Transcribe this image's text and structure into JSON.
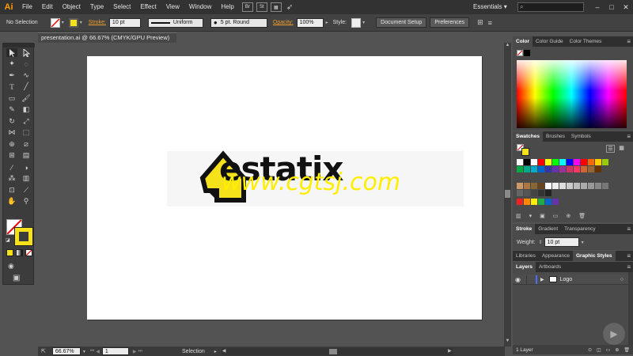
{
  "app": {
    "logo": "Ai"
  },
  "menu": [
    "File",
    "Edit",
    "Object",
    "Type",
    "Select",
    "Effect",
    "View",
    "Window",
    "Help"
  ],
  "bridge": [
    "Br",
    "St"
  ],
  "workspace": {
    "label": "Essentials",
    "arrow": "▾"
  },
  "search": {
    "placeholder": ""
  },
  "window_controls": {
    "minimize": "–",
    "maximize": "□",
    "close": "✕"
  },
  "control": {
    "selection": "No Selection",
    "stroke_label": "Stroke:",
    "stroke_weight": "10 pt",
    "profile": "Uniform",
    "brush": "5 pt. Round",
    "opacity_label": "Opacity:",
    "opacity": "100%",
    "style_label": "Style:",
    "doc_setup": "Document Setup",
    "preferences": "Preferences"
  },
  "doc": {
    "tab": "presentation.ai @ 66.67% (CMYK/GPU Preview)",
    "close": "✕"
  },
  "artboard": {
    "logo_text": "estatix",
    "watermark": "www.cgtsj.com"
  },
  "status": {
    "zoom": "66.67%",
    "page": "1",
    "tool": "Selection"
  },
  "panels": {
    "color_tabs": [
      "Color",
      "Color Guide",
      "Color Themes"
    ],
    "swatch_tabs": [
      "Swatches",
      "Brushes",
      "Symbols"
    ],
    "stroke_tabs": [
      "Stroke",
      "Gradient",
      "Transparency"
    ],
    "weight_label": "Weight:",
    "weight": "10 pt",
    "lib_tabs": [
      "Libraries",
      "Appearance",
      "Graphic Styles"
    ],
    "layer_tabs": [
      "Layers",
      "Artboards"
    ],
    "layer_name": "Logo",
    "layer_count": "1 Layer"
  },
  "colors": {
    "accent_orange": "#ff9a00",
    "logo_yellow": "#f5e21a",
    "stroke_label": "#f0a030"
  },
  "swatch_rows": [
    [
      "#ffffff",
      "#000000",
      "#ffffff",
      "#ff0000",
      "#ffff00",
      "#00ff00",
      "#00ffff",
      "#0000ff",
      "#ff00ff",
      "#ff0000",
      "#ff6600",
      "#ffcc00",
      "#99cc00",
      "#00aa44",
      "#00aa88",
      "#00aacc",
      "#0066cc",
      "#3333aa",
      "#6633aa",
      "#993399",
      "#cc3366",
      "#ff3366",
      "#cc6633",
      "#996633",
      "#663300"
    ],
    [
      "#cc9966",
      "#aa7744",
      "#886633",
      "#664422",
      "#ffffff",
      "#eeeeee",
      "#dddddd",
      "#cccccc",
      "#bbbbbb",
      "#aaaaaa",
      "#999999",
      "#888888",
      "#777777",
      "#666666",
      "#555555",
      "#444444",
      "#333333",
      "#222222"
    ],
    [
      "#ee2222",
      "#ff8800",
      "#ffee00",
      "#22aa44",
      "#0066cc",
      "#6633aa"
    ]
  ],
  "icons": [
    "selection-icon",
    "direct-selection-icon",
    "magic-wand-icon",
    "lasso-icon",
    "pen-icon",
    "curvature-icon",
    "type-icon",
    "line-icon",
    "rectangle-icon",
    "paintbrush-icon",
    "pencil-icon",
    "eraser-icon",
    "rotate-icon",
    "scale-icon",
    "width-icon",
    "free-transform-icon",
    "shape-builder-icon",
    "perspective-icon",
    "mesh-icon",
    "gradient-icon",
    "eyedropper-icon",
    "blend-icon",
    "symbol-sprayer-icon",
    "graph-icon",
    "artboard-icon",
    "slice-icon",
    "hand-icon",
    "zoom-icon"
  ]
}
